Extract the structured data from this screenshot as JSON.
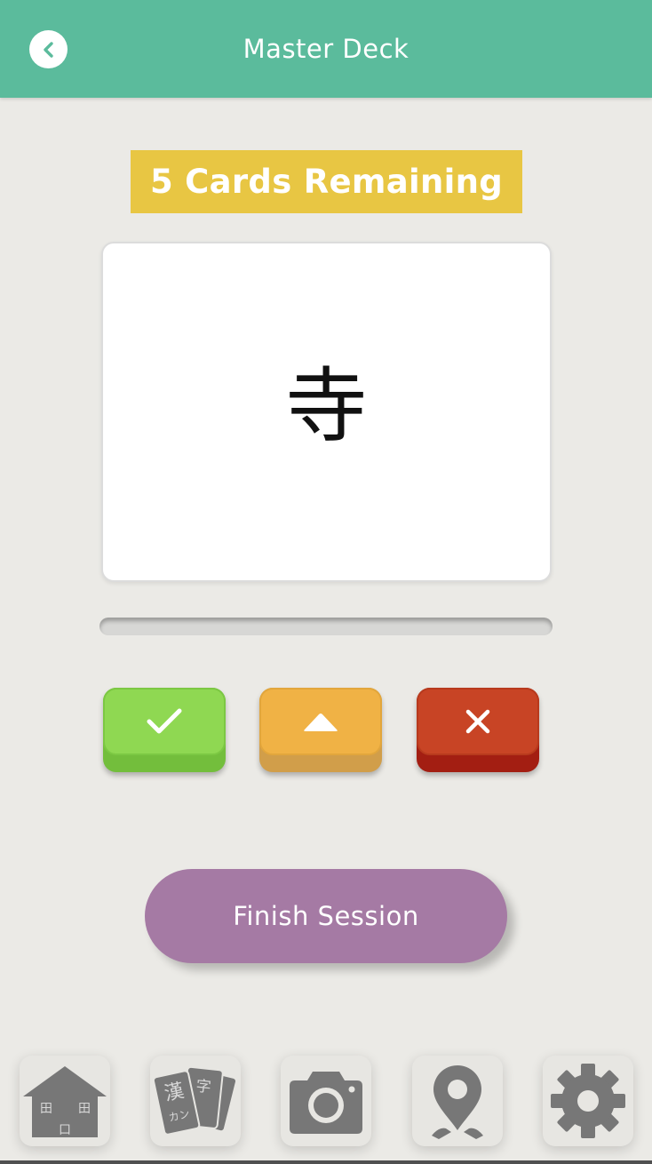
{
  "header": {
    "title": "Master Deck",
    "back_icon": "chevron-left-icon"
  },
  "session": {
    "remaining_label": "5 Cards Remaining",
    "card_character": "寺",
    "progress_fraction": 0
  },
  "answer_buttons": [
    {
      "name": "correct",
      "icon": "check-icon",
      "color": "#8fd852"
    },
    {
      "name": "review",
      "icon": "triangle-up-icon",
      "color": "#f0b245"
    },
    {
      "name": "wrong",
      "icon": "close-icon",
      "color": "#c84425"
    }
  ],
  "finish_button": {
    "label": "Finish Session",
    "color": "#a57aa4"
  },
  "bottom_nav": {
    "home_icon_chars": [
      "田",
      "田",
      "口"
    ],
    "cards_icon_chars": [
      "漢",
      "字",
      "カン"
    ],
    "items": [
      "home-icon",
      "kanji-cards-icon",
      "camera-icon",
      "map-pin-icon",
      "gear-icon"
    ]
  },
  "theme": {
    "accent": "#5bbb9c",
    "badge": "#e8c643",
    "background": "#ebeae6",
    "icon_gray": "#777777"
  }
}
